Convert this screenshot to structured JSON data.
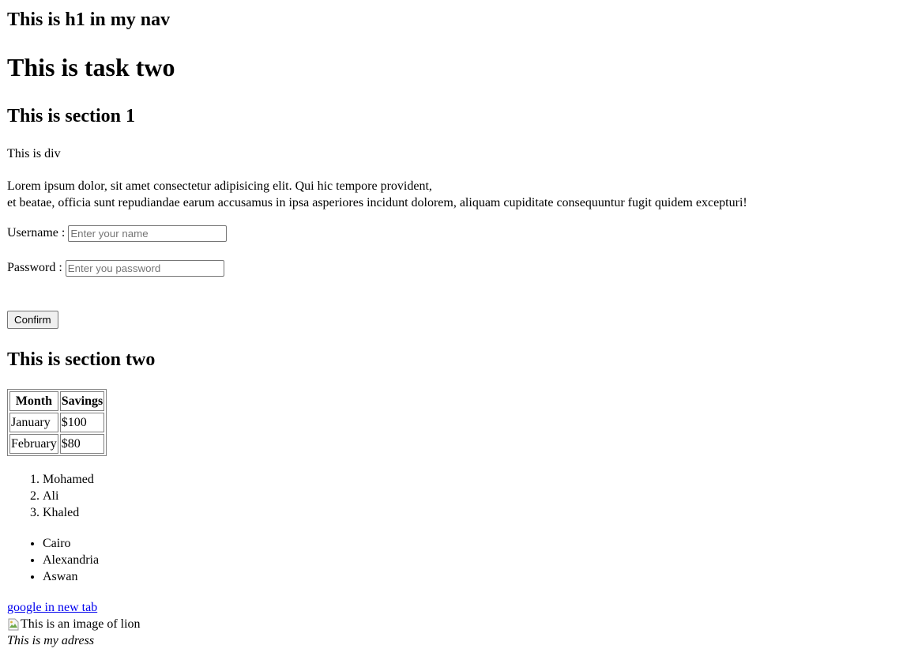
{
  "nav": {
    "title": "This is h1 in my nav"
  },
  "main": {
    "title": "This is task two"
  },
  "section1": {
    "title": "This is section 1",
    "div_text": "This is div",
    "paragraph_line1": "Lorem ipsum dolor, sit amet consectetur adipisicing elit. Qui hic tempore provident,",
    "paragraph_line2": "et beatae, officia sunt repudiandae earum accusamus in ipsa asperiores incidunt dolorem, aliquam cupiditate consequuntur fugit quidem excepturi!",
    "form": {
      "username_label": "Username :",
      "username_placeholder": "Enter your name",
      "password_label": "Password :",
      "password_placeholder": "Enter you password",
      "confirm_label": "Confirm"
    }
  },
  "section2": {
    "title": "This is section two",
    "table": {
      "headers": [
        "Month",
        "Savings"
      ],
      "rows": [
        [
          "January",
          "$100"
        ],
        [
          "February",
          "$80"
        ]
      ]
    },
    "ordered_list": [
      "Mohamed",
      "Ali",
      "Khaled"
    ],
    "unordered_list": [
      "Cairo",
      "Alexandria",
      "Aswan"
    ],
    "link_text": "google in new tab",
    "image_alt": "This is an image of lion",
    "address": "This is my adress"
  }
}
